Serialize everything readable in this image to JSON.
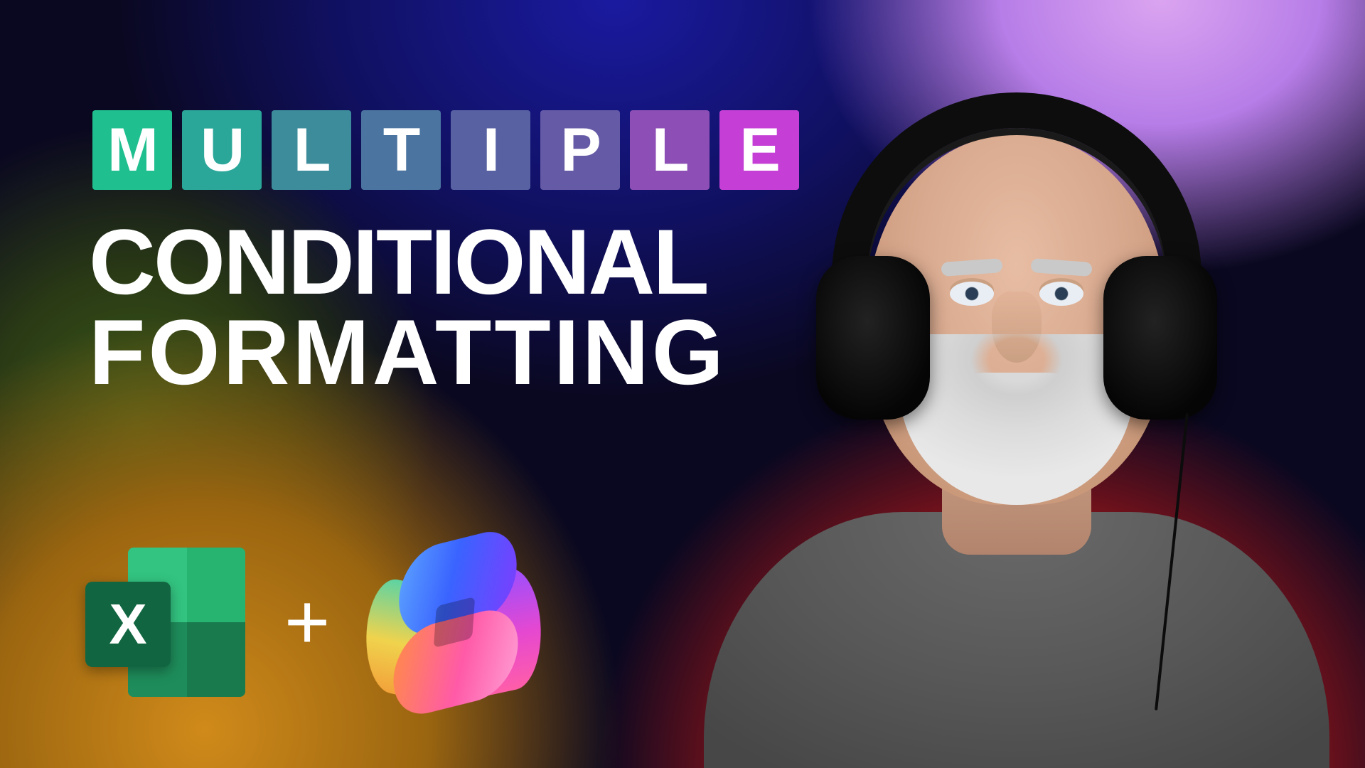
{
  "tiles": {
    "letters": [
      "M",
      "U",
      "L",
      "T",
      "I",
      "P",
      "L",
      "E"
    ],
    "colors": [
      "#1fbf8f",
      "#2ba79a",
      "#3c8c9c",
      "#4b75a0",
      "#5862a3",
      "#655aa6",
      "#8d4fb5",
      "#c53fd6"
    ]
  },
  "headline": {
    "line1": "CONDITIONAL",
    "line2": "FORMATTING"
  },
  "logos": {
    "plus": "+",
    "excel_letter": "X",
    "excel_name": "excel-icon",
    "copilot_name": "copilot-icon"
  },
  "presenter": {
    "description": "man-with-headphones"
  }
}
